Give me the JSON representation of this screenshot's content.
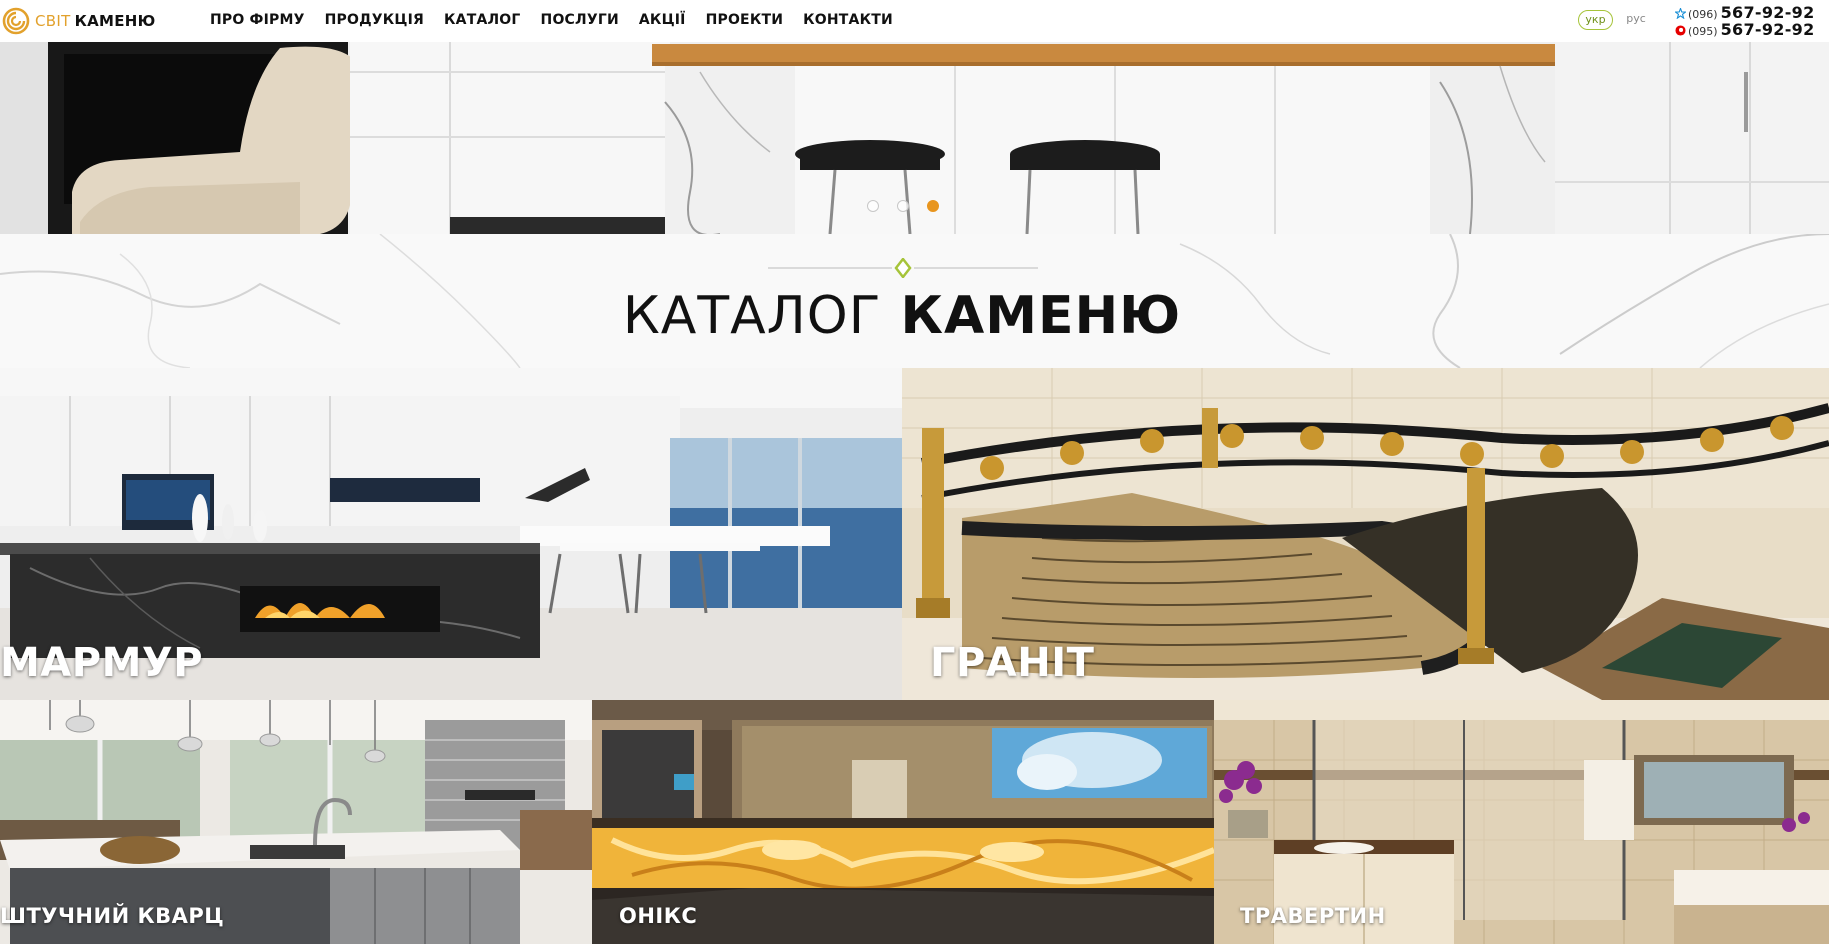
{
  "brand": {
    "name_light": "СВІТ",
    "name_bold": "КАМЕНЮ",
    "logo_icon": "spiral-logo-icon",
    "accent": "#e2a12c"
  },
  "nav": {
    "items": [
      {
        "label": "ПРО ФІРМУ"
      },
      {
        "label": "ПРОДУКЦІЯ"
      },
      {
        "label": "КАТАЛОГ"
      },
      {
        "label": "ПОСЛУГИ"
      },
      {
        "label": "АКЦІЇ"
      },
      {
        "label": "ПРОЕКТИ"
      },
      {
        "label": "КОНТАКТИ"
      }
    ]
  },
  "languages": {
    "active": "укр",
    "other": "рус",
    "active_color": "#a6c43a"
  },
  "phones": [
    {
      "icon": "kyivstar-star-icon",
      "code": "(096)",
      "number": "567-92-92"
    },
    {
      "icon": "vodafone-icon",
      "code": "(095)",
      "number": "567-92-92"
    }
  ],
  "hero": {
    "slide_count": 3,
    "active_slide": 3,
    "dot_active_color": "#e8951e"
  },
  "catalog": {
    "title_light": "КАТАЛОГ",
    "title_bold": "КАМЕНЮ",
    "ornament_color": "#a6c43a",
    "categories": [
      {
        "label": "МАРМУР"
      },
      {
        "label": "ГРАНІТ"
      },
      {
        "label": "ШТУЧНИЙ КВАРЦ"
      },
      {
        "label": "ОНІКС"
      },
      {
        "label": "ТРАВЕРТИН"
      }
    ]
  }
}
